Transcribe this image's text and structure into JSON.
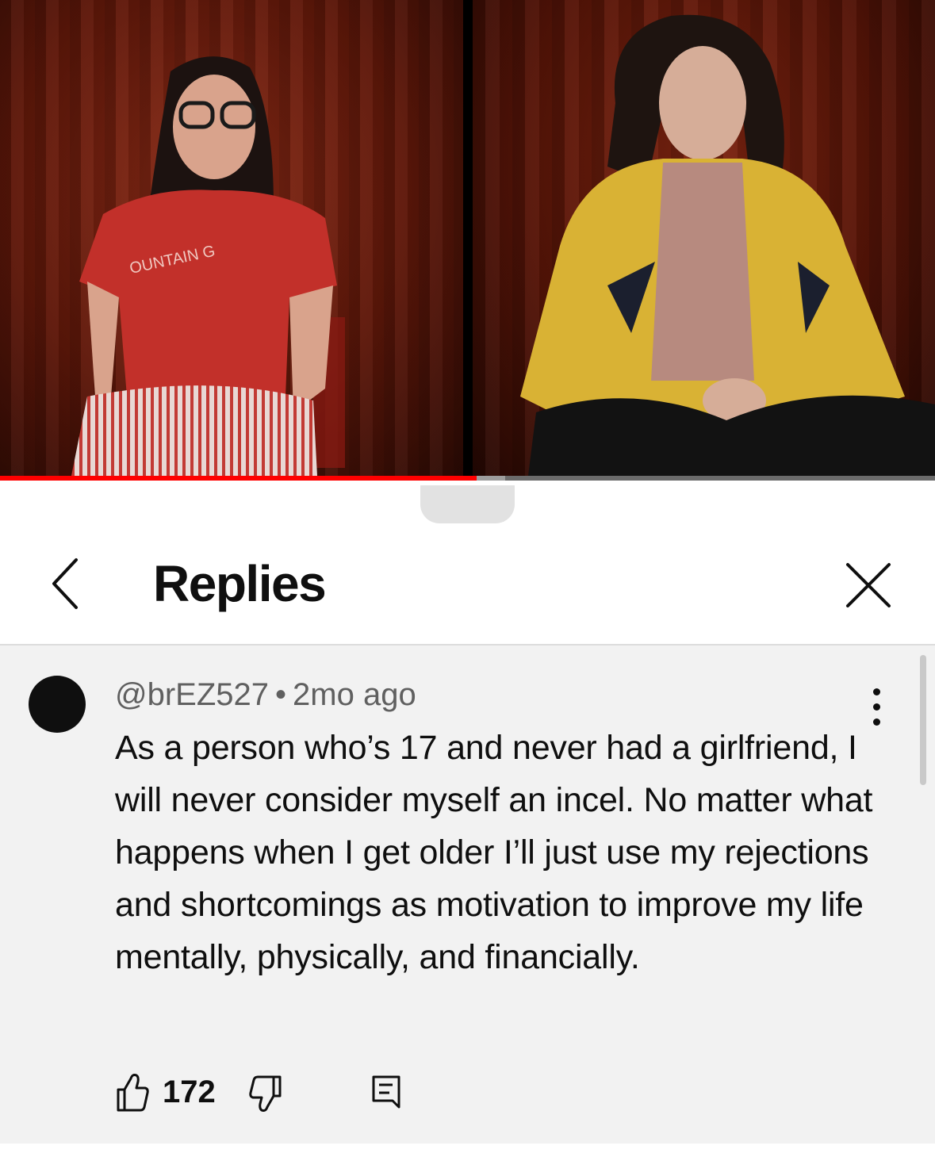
{
  "video": {
    "progress_played_fraction": 0.51,
    "progress_buffered_fraction": 0.54,
    "colors": {
      "played": "#ff0000",
      "buffered": "#9e9e9e",
      "track": "#6b6b6b"
    },
    "left_shirt_text": "OUNTAIN G"
  },
  "sheet": {
    "title": "Replies",
    "back_icon": "chevron-left-icon",
    "close_icon": "close-icon"
  },
  "comment": {
    "author": "@brEZ527",
    "separator": "•",
    "time": "2mo ago",
    "text": "As a person who’s 17 and never had a girlfriend, I will never consider myself an incel. No matter what happens when I get older I’ll just use my rejections and shortcomings as motivation to improve my life mentally, physically, and financially.",
    "like_count": "172",
    "icons": {
      "more": "more-vertical-icon",
      "like": "thumbs-up-icon",
      "dislike": "thumbs-down-icon",
      "reply": "reply-comment-icon"
    }
  }
}
